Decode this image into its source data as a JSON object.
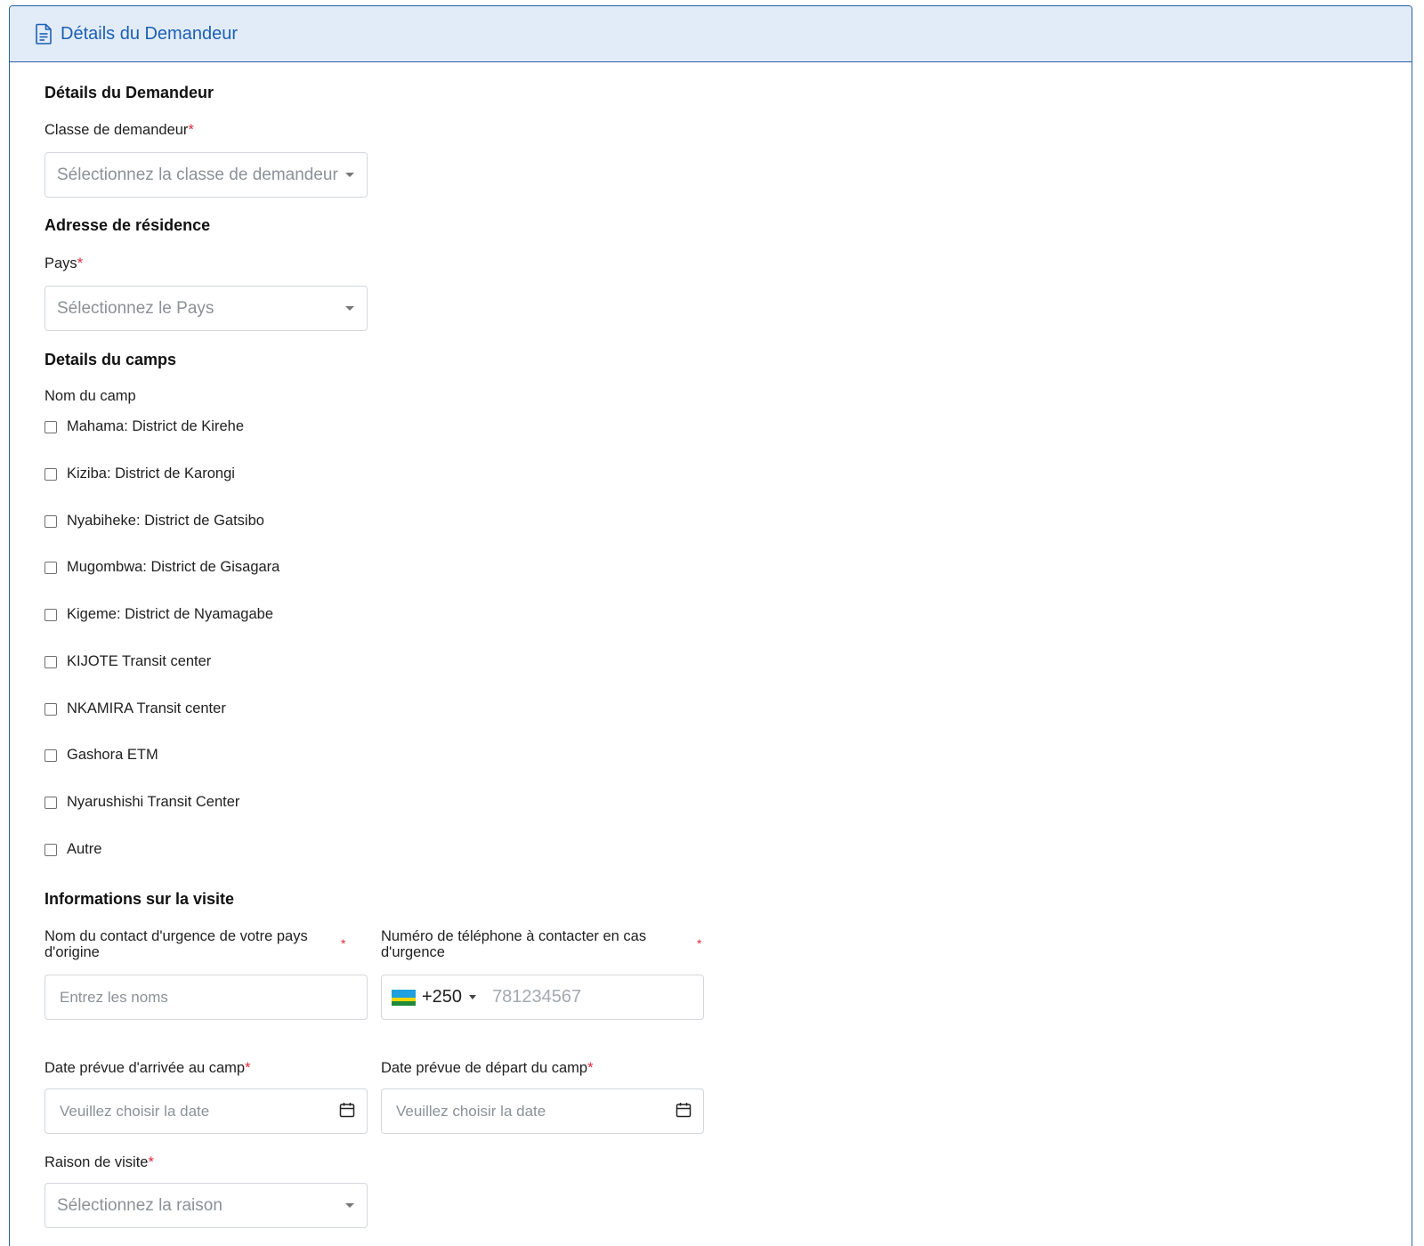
{
  "header": {
    "title": "Détails du Demandeur",
    "icon": "document-icon"
  },
  "sections": {
    "applicant": {
      "title": "Détails du Demandeur",
      "class_label": "Classe de demandeur",
      "class_placeholder": "Sélectionnez la classe de demandeur"
    },
    "residence": {
      "title": "Adresse de résidence",
      "country_label": "Pays",
      "country_placeholder": "Sélectionnez le Pays"
    },
    "camps": {
      "title": "Details du camps",
      "camp_name_label": "Nom du camp",
      "options": [
        "Mahama: District de Kirehe",
        "Kiziba: District de Karongi",
        "Nyabiheke: District de Gatsibo",
        "Mugombwa: District de Gisagara",
        "Kigeme: District de Nyamagabe",
        "KIJOTE Transit center",
        "NKAMIRA Transit center",
        "Gashora ETM",
        "Nyarushishi Transit Center",
        "Autre"
      ]
    },
    "visit": {
      "title": "Informations sur la visite",
      "emergency_name_label": "Nom du contact d'urgence de votre pays d'origine",
      "emergency_name_placeholder": "Entrez les noms",
      "emergency_phone_label": "Numéro de téléphone à contacter en cas d'urgence",
      "phone_country_code": "+250",
      "phone_placeholder": "781234567",
      "arrival_label": "Date prévue d'arrivée au camp",
      "arrival_placeholder": "Veuillez choisir la date",
      "departure_label": "Date prévue de départ du camp",
      "departure_placeholder": "Veuillez choisir la date",
      "reason_label": "Raison de visite",
      "reason_placeholder": "Sélectionnez la raison"
    }
  },
  "required_marker": "*",
  "colors": {
    "accent": "#1d5fb3",
    "header_bg": "#e1ecf8",
    "required": "#e0283b"
  }
}
